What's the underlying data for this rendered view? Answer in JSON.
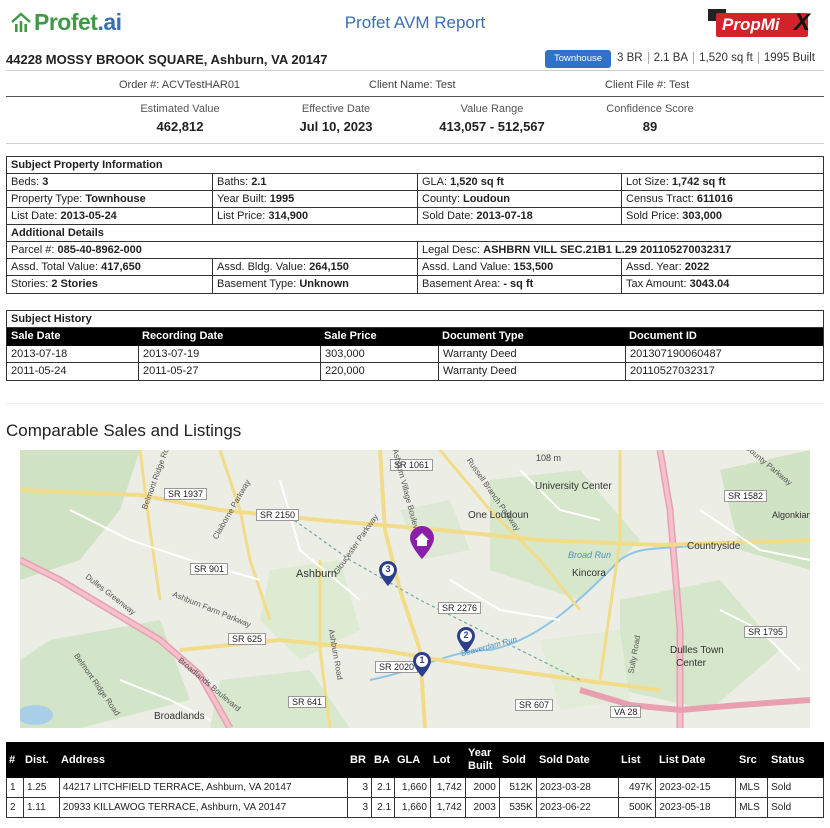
{
  "header": {
    "logo_left_main": "Profet",
    "logo_left_suffix": ".ai",
    "title": "Profet AVM Report",
    "logo_right_main": "PropMi",
    "logo_right_x": "X"
  },
  "property": {
    "address": "44228 MOSSY BROOK SQUARE, Ashburn, VA 20147",
    "type_badge": "Townhouse",
    "beds": "3 BR",
    "baths": "2.1 BA",
    "sqft": "1,520 sq ft",
    "built": "1995 Built"
  },
  "order": {
    "order_no": "Order #: ACVTestHAR01",
    "client_name": "Client Name: Test",
    "client_file": "Client File #: Test"
  },
  "metrics": [
    {
      "label": "Estimated Value",
      "value": "462,812"
    },
    {
      "label": "Effective Date",
      "value": "Jul 10, 2023"
    },
    {
      "label": "Value Range",
      "value": "413,057 - 512,567"
    },
    {
      "label": "Confidence Score",
      "value": "89"
    }
  ],
  "subject": {
    "title": "Subject Property Information",
    "rows": [
      [
        {
          "k": "Beds: ",
          "v": "3"
        },
        {
          "k": "Baths: ",
          "v": "2.1"
        },
        {
          "k": "GLA: ",
          "v": "1,520 sq ft"
        },
        {
          "k": "Lot Size: ",
          "v": "1,742 sq ft"
        }
      ],
      [
        {
          "k": "Property Type: ",
          "v": "Townhouse"
        },
        {
          "k": "Year Built: ",
          "v": "1995"
        },
        {
          "k": "County: ",
          "v": "Loudoun"
        },
        {
          "k": "Census Tract: ",
          "v": "611016"
        }
      ],
      [
        {
          "k": "List Date: ",
          "v": "2013-05-24"
        },
        {
          "k": "List Price: ",
          "v": "314,900"
        },
        {
          "k": "Sold Date: ",
          "v": "2013-07-18"
        },
        {
          "k": "Sold Price: ",
          "v": "303,000"
        }
      ]
    ],
    "additional_title": "Additional Details",
    "parcel": {
      "k": "Parcel #: ",
      "v": "085-40-8962-000"
    },
    "legal": {
      "k": "Legal Desc: ",
      "v": "ASHBRN VILL SEC.21B1 L.29 201105270032317"
    },
    "rows2": [
      [
        {
          "k": "Assd. Total Value: ",
          "v": "417,650"
        },
        {
          "k": "Assd. Bldg. Value: ",
          "v": "264,150"
        },
        {
          "k": "Assd. Land Value: ",
          "v": "153,500"
        },
        {
          "k": "Assd. Year: ",
          "v": "2022"
        }
      ],
      [
        {
          "k": "Stories: ",
          "v": "2 Stories"
        },
        {
          "k": "Basement Type: ",
          "v": "Unknown"
        },
        {
          "k": "Basement Area: ",
          "v": "- sq ft"
        },
        {
          "k": "Tax Amount: ",
          "v": "3043.04"
        }
      ]
    ]
  },
  "history": {
    "title": "Subject History",
    "columns": [
      "Sale Date",
      "Recording Date",
      "Sale Price",
      "Document Type",
      "Document ID"
    ],
    "rows": [
      [
        "2013-07-18",
        "2013-07-19",
        "303,000",
        "Warranty Deed",
        "201307190060487"
      ],
      [
        "2011-05-24",
        "2011-05-27",
        "220,000",
        "Warranty Deed",
        "20110527032317"
      ]
    ]
  },
  "comps_section_title": "Comparable Sales and Listings",
  "map": {
    "labels": [
      "SR 1061",
      "University Center",
      "SR 1582",
      "Algonkian",
      "SR 1937",
      "SR 2150",
      "One Loudoun",
      "Countryside",
      "SR 901",
      "Ashburn",
      "Kincora",
      "Broad Run",
      "SR 2276",
      "SR 625",
      "SR 1795",
      "Dulles Town",
      "Center",
      "SR 2020",
      "SR 641",
      "SR 607",
      "VA 28",
      "Broadlands",
      "108 m",
      "Ashburn Farm Parkway",
      "Claiborne Parkway",
      "Russell Branch Parkway",
      "Loudoun County Parkway",
      "Dulles Greenway",
      "Belmont Ridge Road",
      "Gloucester Parkway",
      "Beaverdam Run",
      "Broadlands Boulevard",
      "Ashburn Road",
      "Sully Road",
      "Ashburn Village Boulevard",
      "Belmont Ridge Road"
    ],
    "markers": [
      "1",
      "2",
      "3"
    ]
  },
  "comps": {
    "columns": [
      "#",
      "Dist.",
      "Address",
      "BR",
      "BA",
      "GLA",
      "Lot",
      "Year Built",
      "Sold",
      "Sold Date",
      "List",
      "List Date",
      "Src",
      "Status"
    ],
    "rows": [
      [
        "1",
        "1.25",
        "44217 LITCHFIELD TERRACE, Ashburn, VA 20147",
        "3",
        "2.1",
        "1,660",
        "1,742",
        "2000",
        "512K",
        "2023-03-28",
        "497K",
        "2023-02-15",
        "MLS",
        "Sold"
      ],
      [
        "2",
        "1.11",
        "20933 KILLAWOG TERRACE, Ashburn, VA 20147",
        "3",
        "2.1",
        "1,660",
        "1,742",
        "2003",
        "535K",
        "2023-06-22",
        "500K",
        "2023-05-18",
        "MLS",
        "Sold"
      ]
    ]
  },
  "colors": {
    "green": "#3f9a48",
    "blue": "#3a6fb0",
    "red": "#d3222a",
    "badge": "#2f72c7",
    "marker_purple": "#8a1fa8",
    "marker_navy": "#2d3f8c"
  }
}
